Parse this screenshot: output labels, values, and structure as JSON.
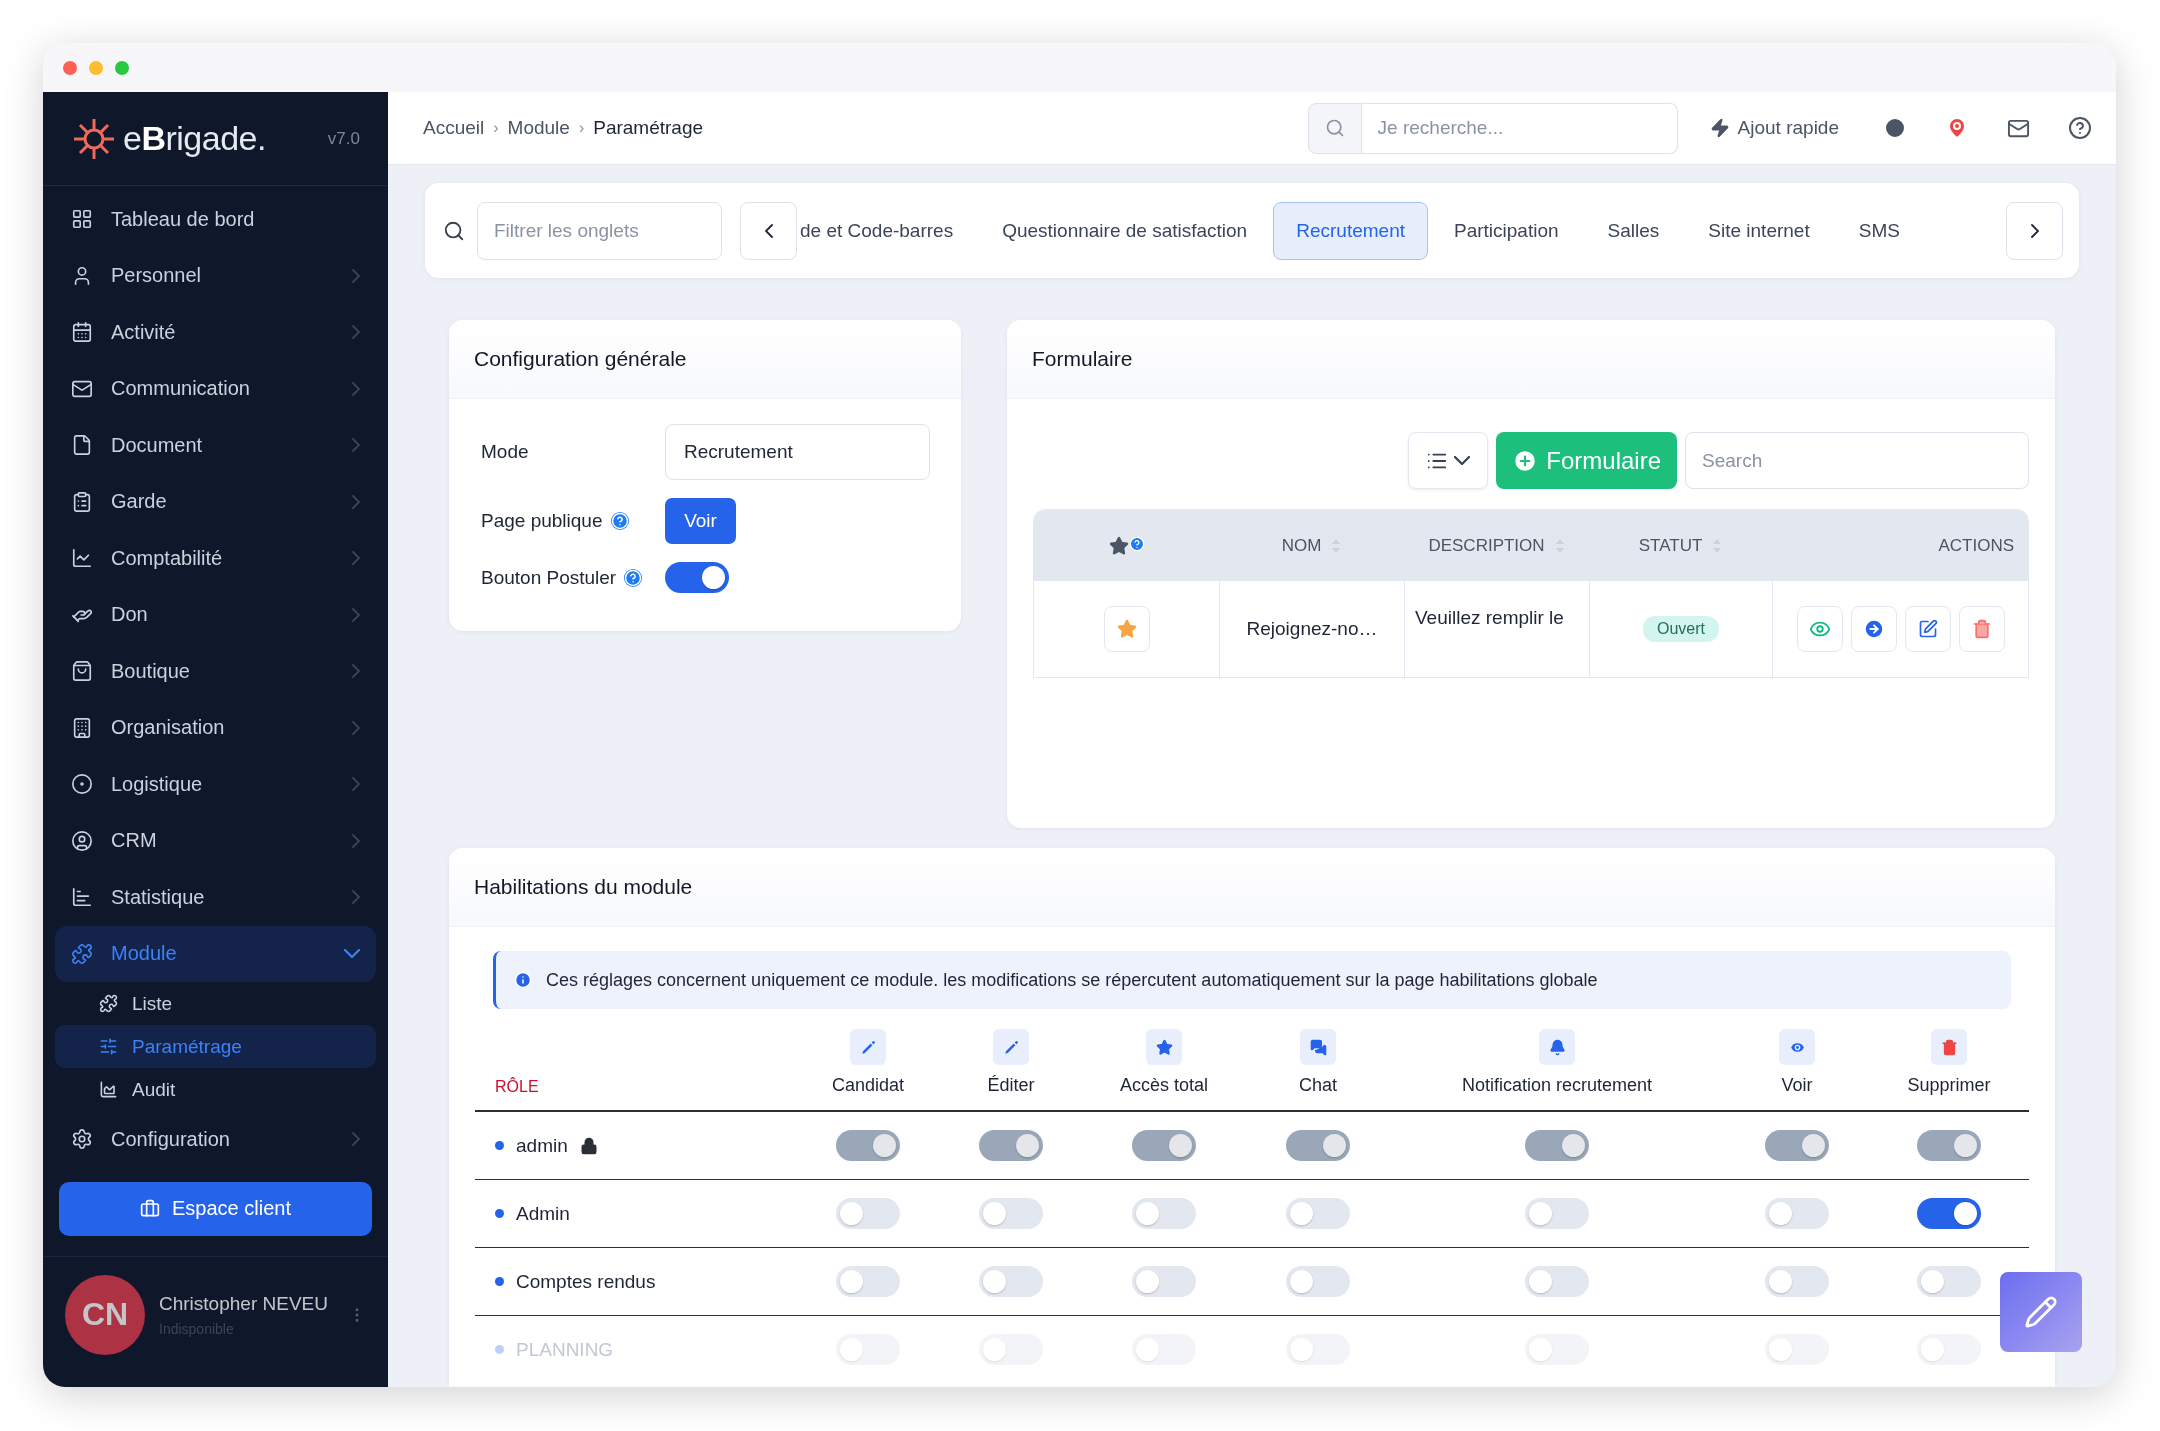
{
  "sidebar": {
    "logo": "e**B**rigade.",
    "version": "v7.0",
    "items": [
      {
        "label": "Tableau de bord",
        "expandable": false,
        "expanded": false,
        "selected": false
      },
      {
        "label": "Personnel",
        "expandable": true,
        "expanded": false,
        "selected": false
      },
      {
        "label": "Activité",
        "expandable": true,
        "expanded": false,
        "selected": false
      },
      {
        "label": "Communication",
        "expandable": true,
        "expanded": false,
        "selected": false
      },
      {
        "label": "Document",
        "expandable": true,
        "expanded": false,
        "selected": false
      },
      {
        "label": "Garde",
        "expandable": true,
        "expanded": false,
        "selected": false
      },
      {
        "label": "Comptabilité",
        "expandable": true,
        "expanded": false,
        "selected": false
      },
      {
        "label": "Don",
        "expandable": true,
        "expanded": false,
        "selected": false
      },
      {
        "label": "Boutique",
        "expandable": true,
        "expanded": false,
        "selected": false
      },
      {
        "label": "Organisation",
        "expandable": true,
        "expanded": false,
        "selected": false
      },
      {
        "label": "Logistique",
        "expandable": true,
        "expanded": false,
        "selected": false
      },
      {
        "label": "CRM",
        "expandable": true,
        "expanded": false,
        "selected": false
      },
      {
        "label": "Statistique",
        "expandable": true,
        "expanded": false,
        "selected": false
      },
      {
        "label": "Module",
        "expandable": true,
        "expanded": true,
        "selected": true,
        "children": [
          {
            "label": "Liste",
            "selected": false
          },
          {
            "label": "Paramétrage",
            "selected": true
          },
          {
            "label": "Audit",
            "selected": false
          }
        ]
      },
      {
        "label": "Configuration",
        "expandable": true,
        "expanded": false,
        "selected": false
      }
    ],
    "cta": "Espace client",
    "user": {
      "initials": "CN",
      "name": "Christopher NEVEU",
      "status": "Indisponible"
    }
  },
  "header": {
    "breadcrumb": [
      "Accueil",
      "Module",
      "Paramétrage"
    ],
    "separator": "›",
    "search": {
      "placeholder": "Je recherche..."
    },
    "quick_add": "Ajout rapide"
  },
  "tabs_bar": {
    "filter": {
      "placeholder": "Filtrer les onglets"
    },
    "tabs": [
      {
        "label": "de et Code-barres",
        "selected": false
      },
      {
        "label": "Questionnaire de satisfaction",
        "selected": false
      },
      {
        "label": "Recrutement",
        "selected": true
      },
      {
        "label": "Participation",
        "selected": false
      },
      {
        "label": "Salles",
        "selected": false
      },
      {
        "label": "Site internet",
        "selected": false
      },
      {
        "label": "SMS",
        "selected": false
      }
    ]
  },
  "config": {
    "title": "Configuration générale",
    "rows": [
      {
        "kind": "select",
        "label": "Mode",
        "help": false,
        "value": "Recrutement"
      },
      {
        "kind": "button",
        "label": "Page publique",
        "help": true,
        "button": "Voir"
      },
      {
        "kind": "toggle",
        "label": "Bouton Postuler",
        "help": true,
        "on": true
      }
    ]
  },
  "form": {
    "title": "Formulaire",
    "add_button": "Formulaire",
    "search": {
      "placeholder": "Search"
    },
    "columns": [
      {
        "label": "NOM",
        "sortable": true
      },
      {
        "label": "DESCRIPTION",
        "sortable": true
      },
      {
        "label": "STATUT",
        "sortable": true
      },
      {
        "label": "ACTIONS",
        "sortable": false
      }
    ],
    "rows": [
      {
        "featured": true,
        "name": "Rejoignez-no…",
        "description": "Veuillez remplir le",
        "status": "Ouvert"
      }
    ]
  },
  "permissions": {
    "title": "Habilitations du module",
    "info": "Ces réglages concernent uniquement ce module. les modifications se répercutent automatiquement sur la page habilitations globale",
    "role_header": "RÔLE",
    "columns": [
      "Candidat",
      "Éditer",
      "Accès total",
      "Chat",
      "Notification recrutement",
      "Voir",
      "Supprimer"
    ],
    "rows": [
      {
        "name": "admin",
        "locked": true,
        "faded": false,
        "cells": [
          {
            "on": true,
            "disabled": true
          },
          {
            "on": true,
            "disabled": true
          },
          {
            "on": true,
            "disabled": true
          },
          {
            "on": true,
            "disabled": true
          },
          {
            "on": true,
            "disabled": true
          },
          {
            "on": true,
            "disabled": true
          },
          {
            "on": true,
            "disabled": true
          }
        ]
      },
      {
        "name": "Admin",
        "locked": false,
        "faded": false,
        "cells": [
          {
            "on": false,
            "disabled": false
          },
          {
            "on": false,
            "disabled": false
          },
          {
            "on": false,
            "disabled": false
          },
          {
            "on": false,
            "disabled": false
          },
          {
            "on": false,
            "disabled": false
          },
          {
            "on": false,
            "disabled": false
          },
          {
            "on": true,
            "disabled": false
          }
        ]
      },
      {
        "name": "Comptes rendus",
        "locked": false,
        "faded": false,
        "cells": [
          {
            "on": false,
            "disabled": false
          },
          {
            "on": false,
            "disabled": false
          },
          {
            "on": false,
            "disabled": false
          },
          {
            "on": false,
            "disabled": false
          },
          {
            "on": false,
            "disabled": false
          },
          {
            "on": false,
            "disabled": false
          },
          {
            "on": false,
            "disabled": false
          }
        ]
      },
      {
        "name": "PLANNING",
        "locked": false,
        "faded": true,
        "cells": [
          {
            "on": false,
            "disabled": false
          },
          {
            "on": false,
            "disabled": false
          },
          {
            "on": false,
            "disabled": false
          },
          {
            "on": false,
            "disabled": false
          },
          {
            "on": false,
            "disabled": false
          },
          {
            "on": false,
            "disabled": false
          },
          {
            "on": false,
            "disabled": false
          }
        ]
      }
    ]
  }
}
